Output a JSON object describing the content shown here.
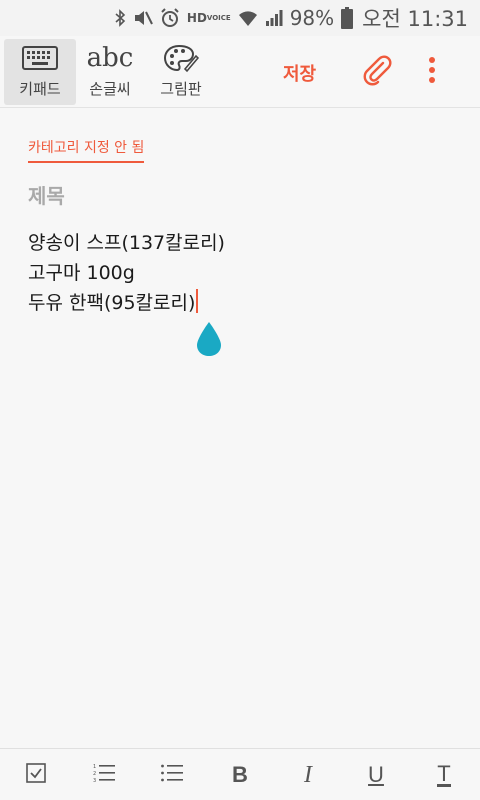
{
  "status_bar": {
    "icons": [
      "bluetooth-icon",
      "mute-icon",
      "alarm-icon",
      "hd-voice-icon",
      "wifi-icon",
      "signal-icon",
      "battery-icon"
    ],
    "hd_top": "HD",
    "hd_bottom": "VOICE",
    "battery": "98%",
    "time": "오전 11:31"
  },
  "toolbar": {
    "keyboard_label": "키패드",
    "handwriting_glyph": "abc",
    "handwriting_label": "손글씨",
    "drawing_label": "그림판",
    "save_label": "저장",
    "attach_icon": "paperclip-icon",
    "more_icon": "more-vertical-icon",
    "accent_color": "#ef5a3c"
  },
  "note": {
    "category": "카테고리 지정 안 됨",
    "title_placeholder": "제목",
    "lines": [
      "양송이 스프(137칼로리)",
      "고구마 100g",
      "두유 한팩(95칼로리)"
    ],
    "handle_color": "#1aa9c4"
  },
  "format_bar": {
    "bold": "B",
    "italic": "I",
    "underline": "U",
    "text_color": "T",
    "icons": [
      "checkbox-icon",
      "numbered-list-icon",
      "bullet-list-icon",
      "bold-icon",
      "italic-icon",
      "underline-icon",
      "text-color-icon"
    ]
  }
}
